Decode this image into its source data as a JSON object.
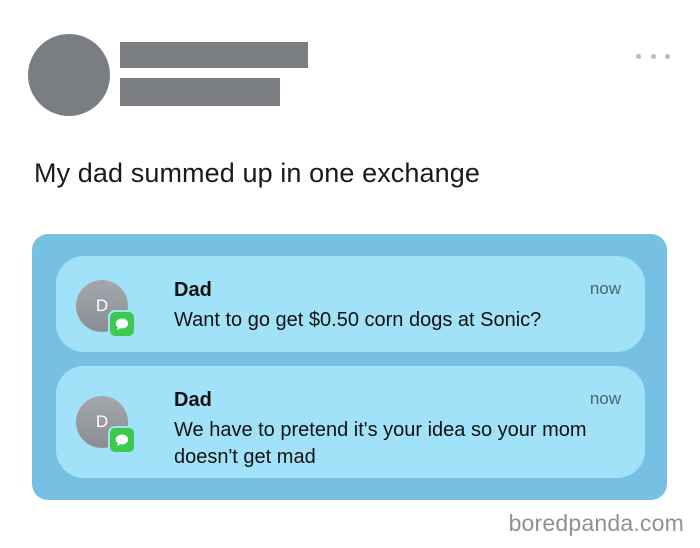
{
  "post": {
    "text": "My dad summed up in one exchange"
  },
  "notifications": [
    {
      "avatar_initial": "D",
      "sender": "Dad",
      "time": "now",
      "message": "Want to go get $0.50 corn dogs at Sonic?",
      "app_icon": "message-bubble-icon"
    },
    {
      "avatar_initial": "D",
      "sender": "Dad",
      "time": "now",
      "message": "We have to pretend it's your idea so your mom doesn't get mad",
      "app_icon": "message-bubble-icon"
    }
  ],
  "watermark": "boredpanda.com",
  "colors": {
    "panel": "#76c1e3",
    "card": "#a2e2f8",
    "badge": "#3dc94e",
    "redaction": "#7a7e83"
  }
}
